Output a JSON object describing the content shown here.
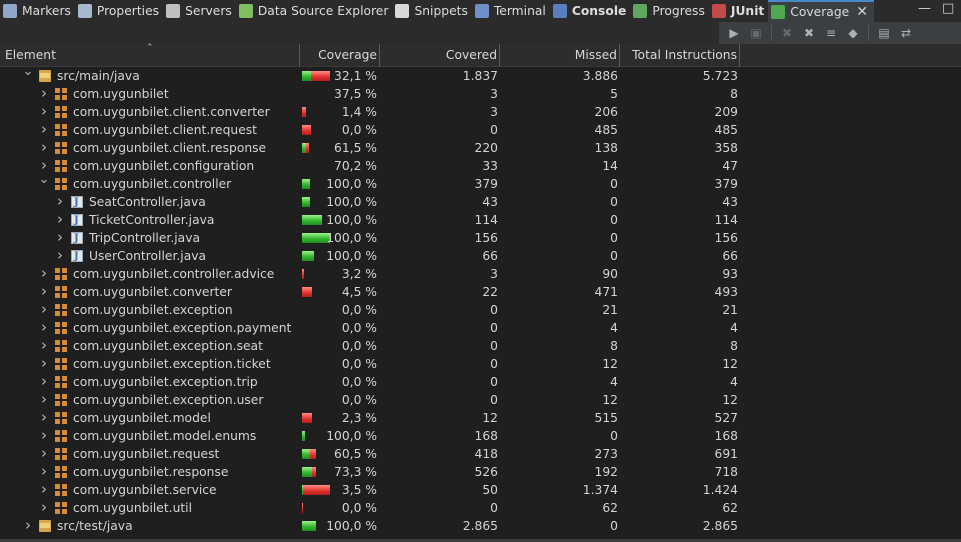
{
  "tabs": [
    {
      "label": "Markers",
      "icon": "markers-icon",
      "color": "#8fa7c8",
      "bold": false,
      "active": false
    },
    {
      "label": "Properties",
      "icon": "properties-icon",
      "color": "#a8b8d0",
      "bold": false,
      "active": false
    },
    {
      "label": "Servers",
      "icon": "servers-icon",
      "color": "#c0c0c0",
      "bold": false,
      "active": false
    },
    {
      "label": "Data Source Explorer",
      "icon": "data-source-explorer-icon",
      "color": "#7fbf5f",
      "bold": false,
      "active": false
    },
    {
      "label": "Snippets",
      "icon": "snippets-icon",
      "color": "#d8d8d8",
      "bold": false,
      "active": false
    },
    {
      "label": "Terminal",
      "icon": "terminal-icon",
      "color": "#6f8fc7",
      "bold": false,
      "active": false
    },
    {
      "label": "Console",
      "icon": "console-icon",
      "color": "#5a7fbf",
      "bold": true,
      "active": false
    },
    {
      "label": "Progress",
      "icon": "progress-icon",
      "color": "#5fa65f",
      "bold": false,
      "active": false
    },
    {
      "label": "JUnit",
      "icon": "junit-icon",
      "color": "#c24a4a",
      "bold": true,
      "active": false
    },
    {
      "label": "Coverage",
      "icon": "coverage-icon",
      "color": "#4fa84f",
      "bold": false,
      "active": true
    }
  ],
  "toolbar": {
    "buttons": [
      "run-coverage-icon",
      "dump-execution-data-icon",
      "remove-session-icon",
      "remove-all-sessions-icon",
      "merge-sessions-icon",
      "select-session-icon",
      "collapse-all-icon",
      "link-with-editor-icon"
    ]
  },
  "columns": {
    "element": "Element",
    "coverage": "Coverage",
    "covered": "Covered Instructions",
    "missed": "Missed Instructions",
    "total": "Total Instructions"
  },
  "colors": {
    "covered_bar": "#2fb52a",
    "missed_bar": "#e0302b"
  },
  "rows": [
    {
      "name": "src/main/java",
      "type": "source-folder",
      "level": 0,
      "expanded": true,
      "coverage": "32,1 %",
      "ratio": 0.321,
      "covered": "1.837",
      "missed": "3.886",
      "total": "5.723",
      "bar_fill": 1.0
    },
    {
      "name": "com.uygunbilet",
      "type": "package",
      "level": 1,
      "expanded": false,
      "coverage": "37,5 %",
      "ratio": 0.375,
      "covered": "3",
      "missed": "5",
      "total": "8",
      "bar_fill": 0.0
    },
    {
      "name": "com.uygunbilet.client.converter",
      "type": "package",
      "level": 1,
      "expanded": false,
      "coverage": "1,4 %",
      "ratio": 0.014,
      "covered": "3",
      "missed": "206",
      "total": "209",
      "bar_fill": 0.15
    },
    {
      "name": "com.uygunbilet.client.request",
      "type": "package",
      "level": 1,
      "expanded": false,
      "coverage": "0,0 %",
      "ratio": 0.0,
      "covered": "0",
      "missed": "485",
      "total": "485",
      "bar_fill": 0.33
    },
    {
      "name": "com.uygunbilet.client.response",
      "type": "package",
      "level": 1,
      "expanded": false,
      "coverage": "61,5 %",
      "ratio": 0.615,
      "covered": "220",
      "missed": "138",
      "total": "358",
      "bar_fill": 0.24
    },
    {
      "name": "com.uygunbilet.configuration",
      "type": "package",
      "level": 1,
      "expanded": false,
      "coverage": "70,2 %",
      "ratio": 0.702,
      "covered": "33",
      "missed": "14",
      "total": "47",
      "bar_fill": 0.0
    },
    {
      "name": "com.uygunbilet.controller",
      "type": "package",
      "level": 1,
      "expanded": true,
      "coverage": "100,0 %",
      "ratio": 1.0,
      "covered": "379",
      "missed": "0",
      "total": "379",
      "bar_fill": 0.27
    },
    {
      "name": "SeatController.java",
      "type": "java-file",
      "level": 2,
      "expanded": false,
      "coverage": "100,0 %",
      "ratio": 1.0,
      "covered": "43",
      "missed": "0",
      "total": "43",
      "bar_fill": 0.27
    },
    {
      "name": "TicketController.java",
      "type": "java-file",
      "level": 2,
      "expanded": false,
      "coverage": "100,0 %",
      "ratio": 1.0,
      "covered": "114",
      "missed": "0",
      "total": "114",
      "bar_fill": 0.73
    },
    {
      "name": "TripController.java",
      "type": "java-file",
      "level": 2,
      "expanded": false,
      "coverage": "100,0 %",
      "ratio": 1.0,
      "covered": "156",
      "missed": "0",
      "total": "156",
      "bar_fill": 1.0
    },
    {
      "name": "UserController.java",
      "type": "java-file",
      "level": 2,
      "expanded": false,
      "coverage": "100,0 %",
      "ratio": 1.0,
      "covered": "66",
      "missed": "0",
      "total": "66",
      "bar_fill": 0.42
    },
    {
      "name": "com.uygunbilet.controller.advice",
      "type": "package",
      "level": 1,
      "expanded": false,
      "coverage": "3,2 %",
      "ratio": 0.032,
      "covered": "3",
      "missed": "90",
      "total": "93",
      "bar_fill": 0.07
    },
    {
      "name": "com.uygunbilet.converter",
      "type": "package",
      "level": 1,
      "expanded": false,
      "coverage": "4,5 %",
      "ratio": 0.045,
      "covered": "22",
      "missed": "471",
      "total": "493",
      "bar_fill": 0.34
    },
    {
      "name": "com.uygunbilet.exception",
      "type": "package",
      "level": 1,
      "expanded": false,
      "coverage": "0,0 %",
      "ratio": 0.0,
      "covered": "0",
      "missed": "21",
      "total": "21",
      "bar_fill": 0.0
    },
    {
      "name": "com.uygunbilet.exception.payment",
      "type": "package",
      "level": 1,
      "expanded": false,
      "coverage": "0,0 %",
      "ratio": 0.0,
      "covered": "0",
      "missed": "4",
      "total": "4",
      "bar_fill": 0.0
    },
    {
      "name": "com.uygunbilet.exception.seat",
      "type": "package",
      "level": 1,
      "expanded": false,
      "coverage": "0,0 %",
      "ratio": 0.0,
      "covered": "0",
      "missed": "8",
      "total": "8",
      "bar_fill": 0.0
    },
    {
      "name": "com.uygunbilet.exception.ticket",
      "type": "package",
      "level": 1,
      "expanded": false,
      "coverage": "0,0 %",
      "ratio": 0.0,
      "covered": "0",
      "missed": "12",
      "total": "12",
      "bar_fill": 0.0
    },
    {
      "name": "com.uygunbilet.exception.trip",
      "type": "package",
      "level": 1,
      "expanded": false,
      "coverage": "0,0 %",
      "ratio": 0.0,
      "covered": "0",
      "missed": "4",
      "total": "4",
      "bar_fill": 0.0
    },
    {
      "name": "com.uygunbilet.exception.user",
      "type": "package",
      "level": 1,
      "expanded": false,
      "coverage": "0,0 %",
      "ratio": 0.0,
      "covered": "0",
      "missed": "12",
      "total": "12",
      "bar_fill": 0.0
    },
    {
      "name": "com.uygunbilet.model",
      "type": "package",
      "level": 1,
      "expanded": false,
      "coverage": "2,3 %",
      "ratio": 0.023,
      "covered": "12",
      "missed": "515",
      "total": "527",
      "bar_fill": 0.37
    },
    {
      "name": "com.uygunbilet.model.enums",
      "type": "package",
      "level": 1,
      "expanded": false,
      "coverage": "100,0 %",
      "ratio": 1.0,
      "covered": "168",
      "missed": "0",
      "total": "168",
      "bar_fill": 0.12
    },
    {
      "name": "com.uygunbilet.request",
      "type": "package",
      "level": 1,
      "expanded": false,
      "coverage": "60,5 %",
      "ratio": 0.605,
      "covered": "418",
      "missed": "273",
      "total": "691",
      "bar_fill": 0.49
    },
    {
      "name": "com.uygunbilet.response",
      "type": "package",
      "level": 1,
      "expanded": false,
      "coverage": "73,3 %",
      "ratio": 0.733,
      "covered": "526",
      "missed": "192",
      "total": "718",
      "bar_fill": 0.5
    },
    {
      "name": "com.uygunbilet.service",
      "type": "package",
      "level": 1,
      "expanded": false,
      "coverage": "3,5 %",
      "ratio": 0.035,
      "covered": "50",
      "missed": "1.374",
      "total": "1.424",
      "bar_fill": 1.0
    },
    {
      "name": "com.uygunbilet.util",
      "type": "package",
      "level": 1,
      "expanded": false,
      "coverage": "0,0 %",
      "ratio": 0.0,
      "covered": "0",
      "missed": "62",
      "total": "62",
      "bar_fill": 0.04
    },
    {
      "name": "src/test/java",
      "type": "source-folder",
      "level": 0,
      "expanded": false,
      "coverage": "100,0 %",
      "ratio": 1.0,
      "covered": "2.865",
      "missed": "0",
      "total": "2.865",
      "bar_fill": 0.5
    }
  ]
}
